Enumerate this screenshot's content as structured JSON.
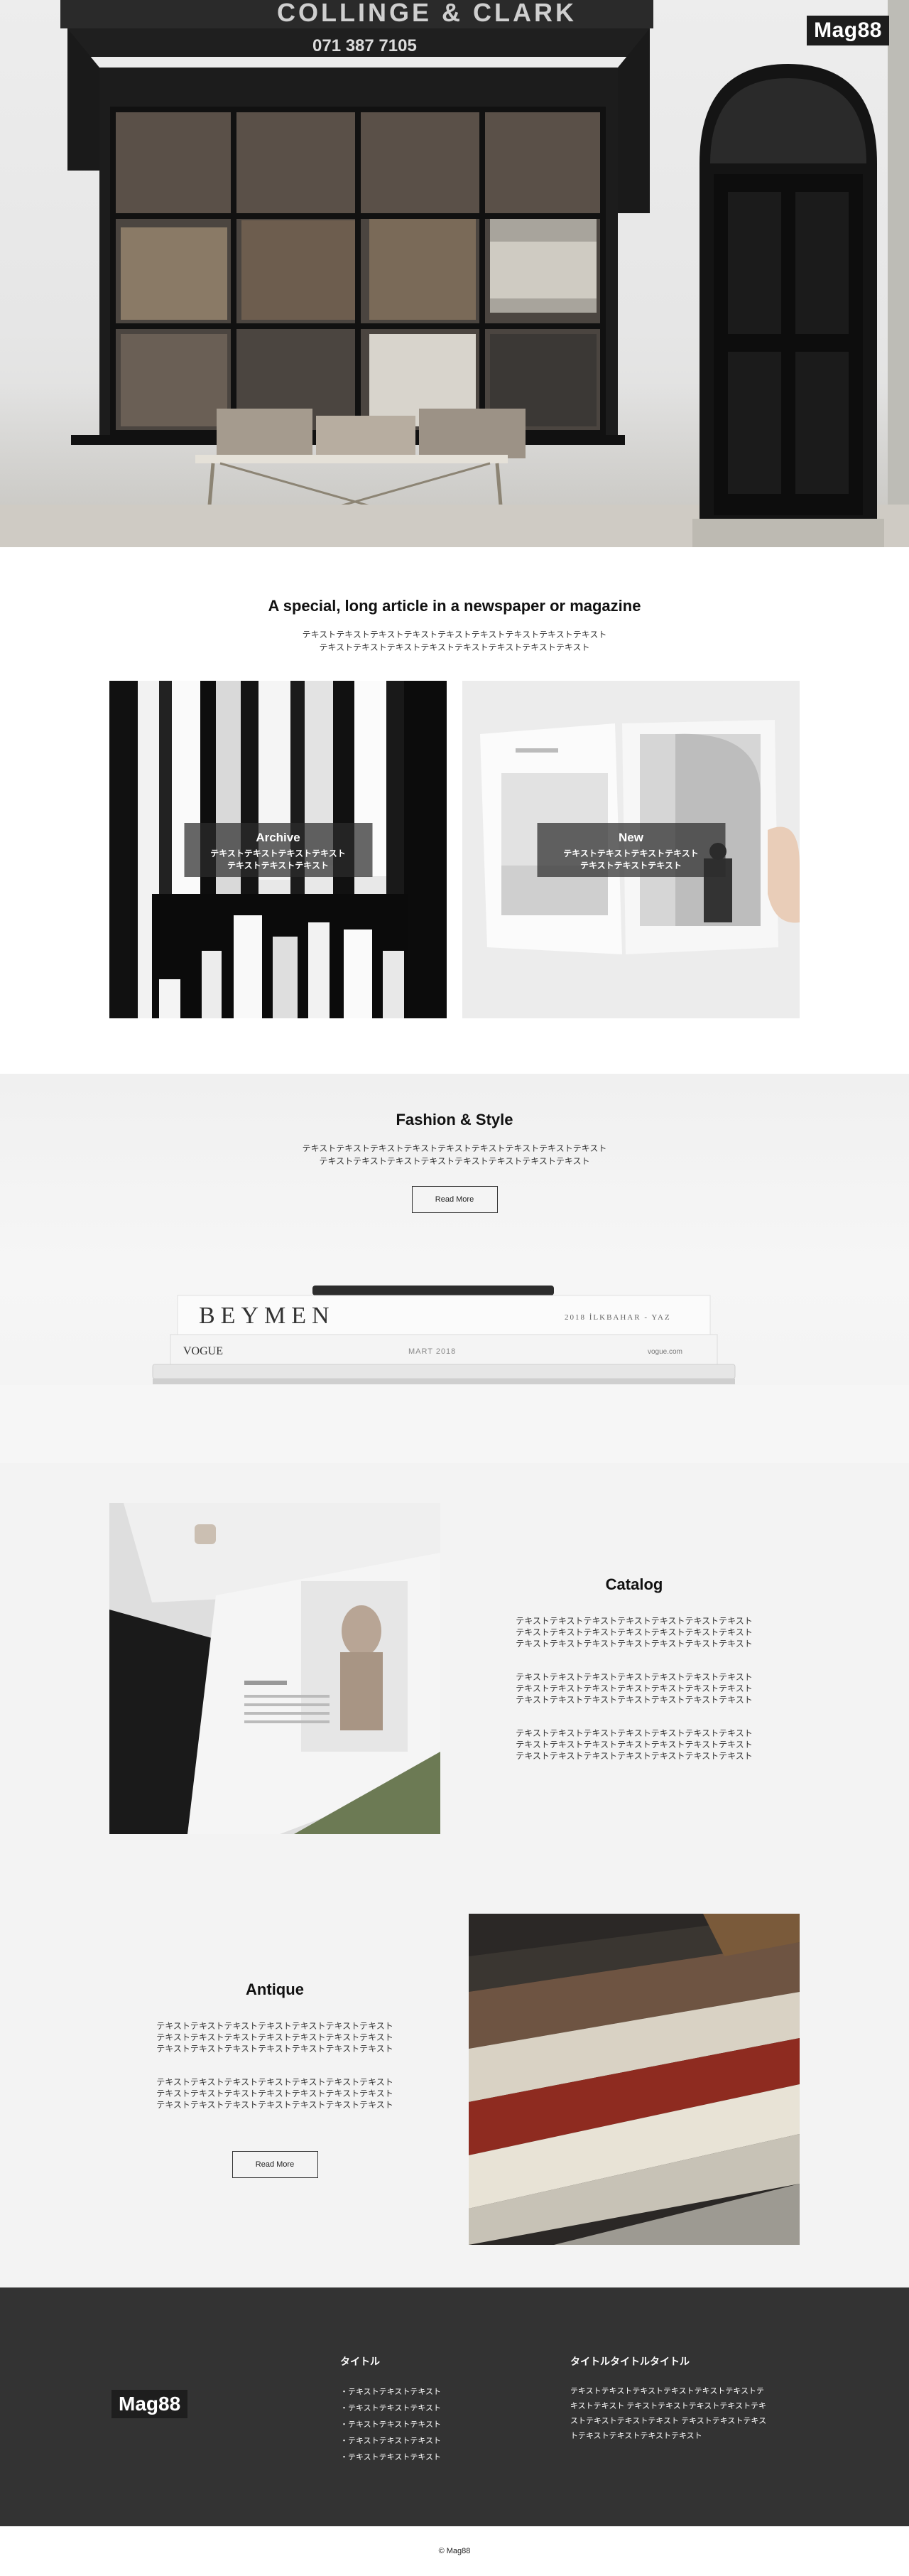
{
  "brand": "Mag88",
  "intro": {
    "title": "A special, long article in a newspaper or magazine",
    "desc_line1": "テキストテキストテキストテキストテキストテキストテキストテキストテキスト",
    "desc_line2": "テキストテキストテキストテキストテキストテキストテキストテキスト"
  },
  "cards": [
    {
      "title": "Archive",
      "line1": "テキストテキストテキストテキスト",
      "line2": "テキストテキストテキスト"
    },
    {
      "title": "New",
      "line1": "テキストテキストテキストテキスト",
      "line2": "テキストテキストテキスト"
    }
  ],
  "fashion": {
    "title": "Fashion & Style",
    "desc_line1": "テキストテキストテキストテキストテキストテキストテキストテキストテキスト",
    "desc_line2": "テキストテキストテキストテキストテキストテキストテキストテキスト",
    "button": "Read More",
    "magazine_top": "BEYMEN",
    "magazine_top_right": "2018 İLKBAHAR - YAZ",
    "magazine_bottom": "VOGUE",
    "magazine_bottom_mid": "MART 2018",
    "magazine_bottom_right": "vogue.com"
  },
  "catalog": {
    "title": "Catalog",
    "paragraphs": [
      [
        "テキストテキストテキストテキストテキストテキストテキスト",
        "テキストテキストテキストテキストテキストテキストテキスト",
        "テキストテキストテキストテキストテキストテキストテキスト"
      ],
      [
        "テキストテキストテキストテキストテキストテキストテキスト",
        "テキストテキストテキストテキストテキストテキストテキスト",
        "テキストテキストテキストテキストテキストテキストテキスト"
      ],
      [
        "テキストテキストテキストテキストテキストテキストテキスト",
        "テキストテキストテキストテキストテキストテキストテキスト",
        "テキストテキストテキストテキストテキストテキストテキスト"
      ]
    ]
  },
  "antique": {
    "title": "Antique",
    "paragraphs": [
      [
        "テキストテキストテキストテキストテキストテキストテキスト",
        "テキストテキストテキストテキストテキストテキストテキスト",
        "テキストテキストテキストテキストテキストテキストテキスト"
      ],
      [
        "テキストテキストテキストテキストテキストテキストテキスト",
        "テキストテキストテキストテキストテキストテキストテキスト",
        "テキストテキストテキストテキストテキストテキストテキスト"
      ]
    ],
    "button": "Read More"
  },
  "footer": {
    "col1_title": "タイトル",
    "col1_items": [
      "・テキストテキストテキスト",
      "・テキストテキストテキスト",
      "・テキストテキストテキスト",
      "・テキストテキストテキスト",
      "・テキストテキストテキスト"
    ],
    "col2_title": "タイトルタイトルタイトル",
    "col2_lines": [
      "テキストテキストテキストテキストテキストテキストテ",
      "キストテキスト テキストテキストテキストテキストテキ",
      "ストテキストテキストテキスト テキストテキストテキス",
      "トテキストテキストテキストテキスト"
    ],
    "copyright": "© Mag88"
  }
}
